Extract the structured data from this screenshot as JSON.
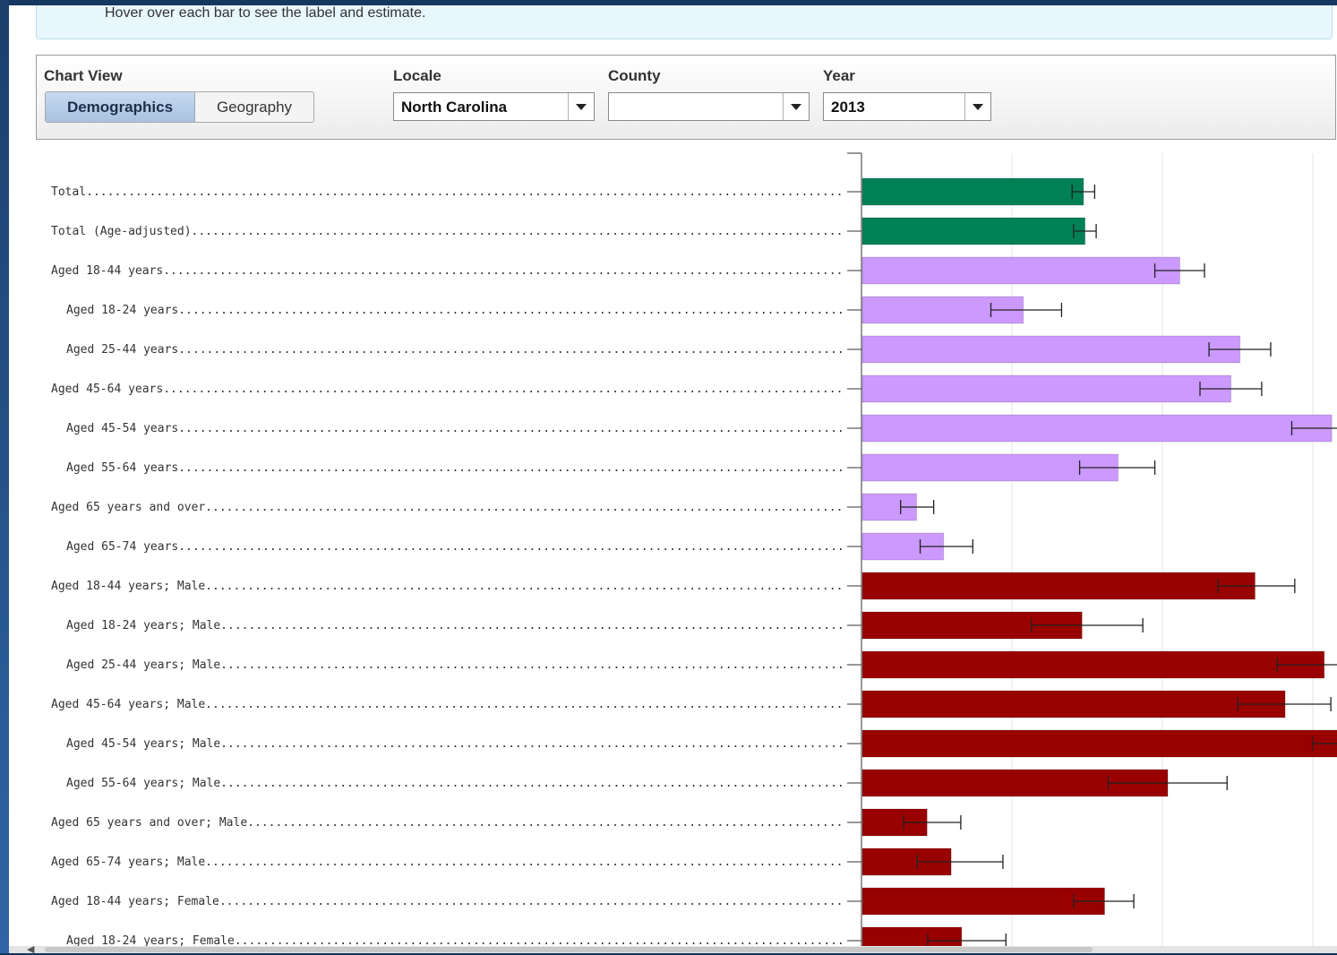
{
  "info": {
    "text": "Hover over each bar to see the label and estimate."
  },
  "controls": {
    "chart_view": {
      "label": "Chart View",
      "options": [
        "Demographics",
        "Geography"
      ],
      "selected": "Demographics"
    },
    "locale": {
      "label": "Locale",
      "value": "North Carolina"
    },
    "county": {
      "label": "County",
      "value": ""
    },
    "year": {
      "label": "Year",
      "value": "2013"
    }
  },
  "colors": {
    "total": "#008055",
    "age": "#cc99ff",
    "male": "#990000"
  },
  "chart_data": {
    "type": "bar",
    "orientation": "horizontal",
    "x_axis": "unlabeled",
    "grid": true,
    "categories": [
      "Total",
      "Total (Age-adjusted)",
      "Aged 18-44 years",
      "Aged 18-24 years",
      "Aged 25-44 years",
      "Aged 45-64 years",
      "Aged 45-54 years",
      "Aged 55-64 years",
      "Aged 65 years and over",
      "Aged 65-74 years",
      "Aged 18-44 years; Male",
      "Aged 18-24 years; Male",
      "Aged 25-44 years; Male",
      "Aged 45-64 years; Male",
      "Aged 45-54 years; Male",
      "Aged 55-64 years; Male",
      "Aged 65 years and over; Male",
      "Aged 65-74 years; Male",
      "Aged 18-44 years; Female",
      "Aged 18-24 years; Female"
    ],
    "indent": [
      0,
      0,
      0,
      1,
      1,
      0,
      1,
      1,
      0,
      1,
      0,
      1,
      1,
      0,
      1,
      1,
      0,
      0,
      0,
      1
    ],
    "group": [
      "total",
      "total",
      "age",
      "age",
      "age",
      "age",
      "age",
      "age",
      "age",
      "age",
      "male",
      "male",
      "male",
      "male",
      "male",
      "male",
      "male",
      "male",
      "male",
      "male"
    ],
    "values": [
      1.47,
      1.48,
      2.11,
      1.07,
      2.51,
      2.45,
      3.12,
      1.7,
      0.36,
      0.54,
      2.61,
      1.46,
      3.07,
      2.81,
      3.2,
      2.03,
      0.43,
      0.59,
      1.61,
      0.66
    ],
    "error_low": [
      1.4,
      1.41,
      1.95,
      0.86,
      2.31,
      2.25,
      2.86,
      1.45,
      0.26,
      0.39,
      2.37,
      1.13,
      2.76,
      2.5,
      3.0,
      1.64,
      0.28,
      0.37,
      1.41,
      0.44
    ],
    "error_high": [
      1.55,
      1.56,
      2.28,
      1.33,
      2.72,
      2.66,
      3.2,
      1.95,
      0.48,
      0.74,
      2.88,
      1.87,
      3.2,
      3.12,
      3.2,
      2.43,
      0.66,
      0.94,
      1.81,
      0.96
    ],
    "xlim": [
      0,
      3.2
    ]
  }
}
